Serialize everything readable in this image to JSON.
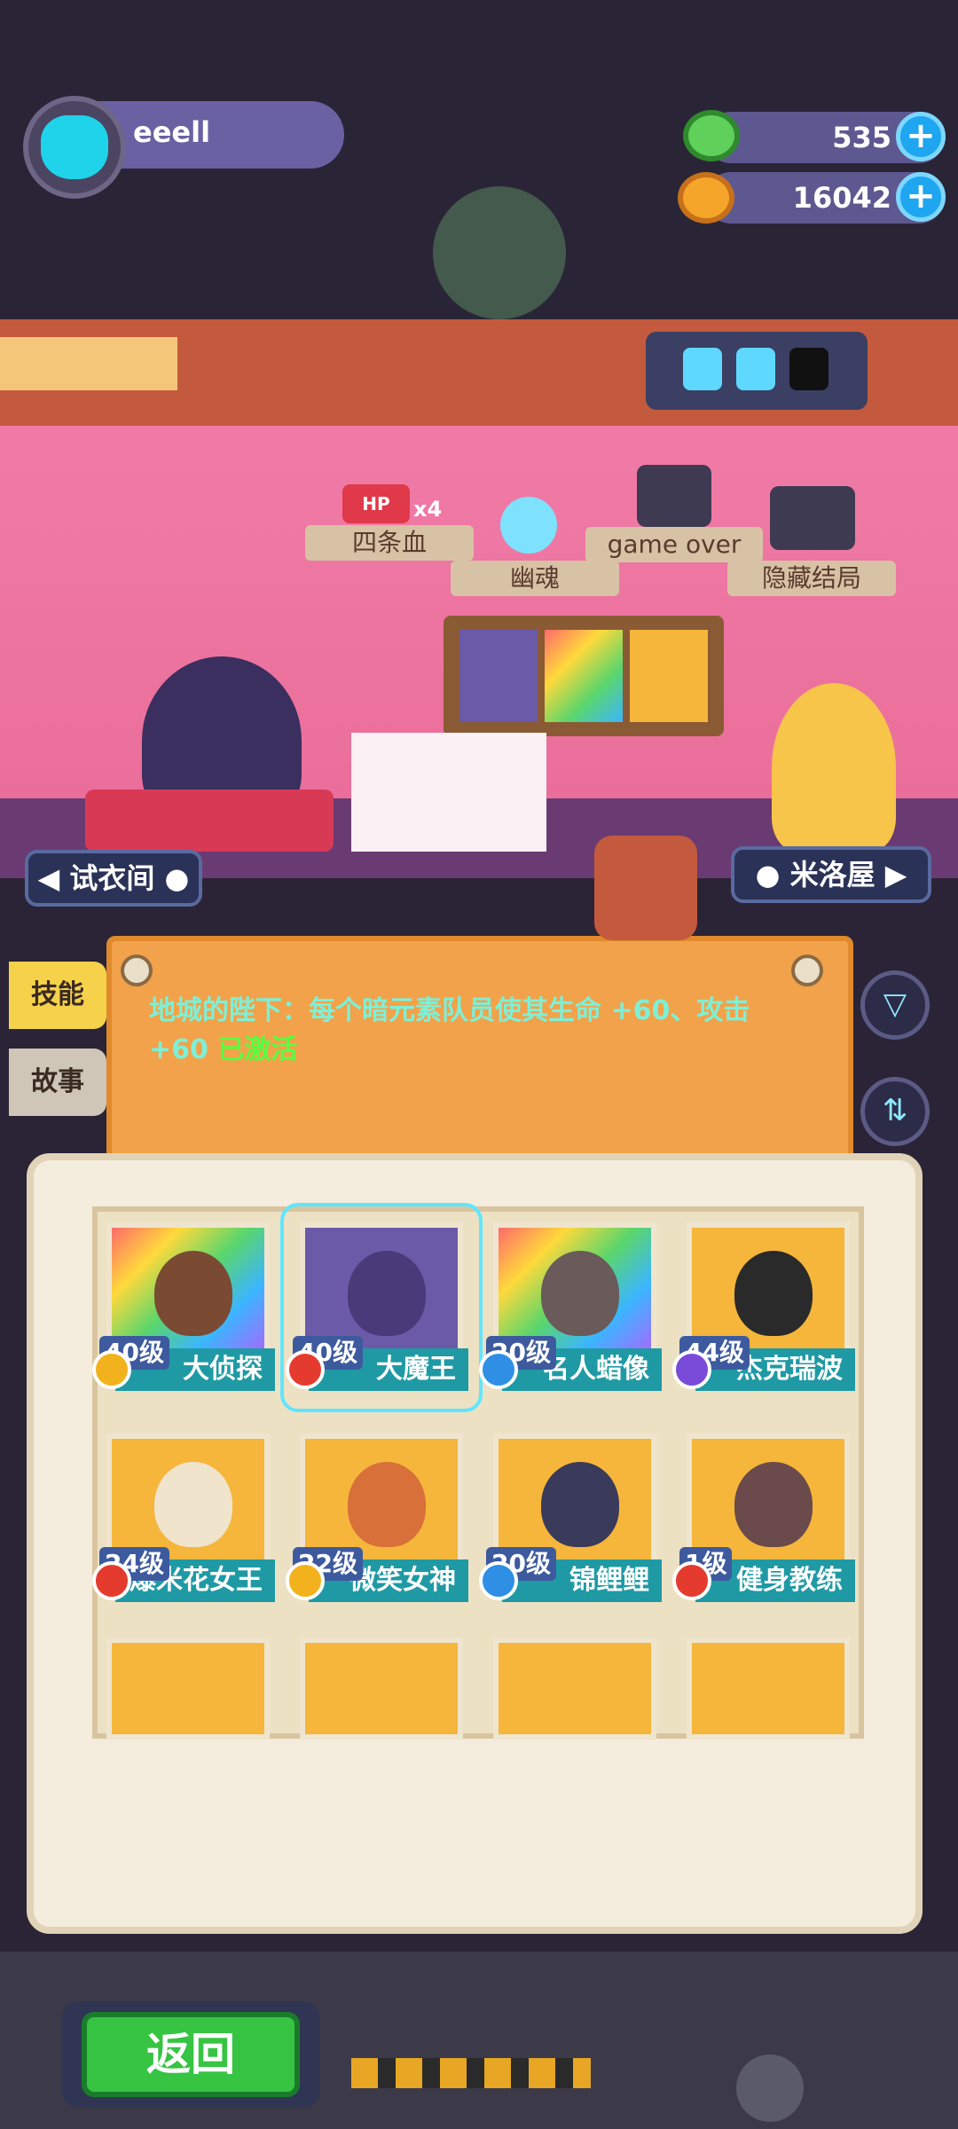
{
  "player": {
    "name": "eeell"
  },
  "currency": [
    {
      "icon": "green-donut-icon",
      "value": "535",
      "color": "#5fd05a"
    },
    {
      "icon": "orange-planet-icon",
      "value": "16042",
      "color": "#f5a52a"
    }
  ],
  "shelf": {
    "hp_badge": "HP",
    "hp_multiplier": "x4",
    "items": [
      "四条血",
      "幽魂",
      "game over",
      "隐藏结局"
    ]
  },
  "nav": {
    "left": "◀ 试衣间 ●",
    "right": "● 米洛屋 ▶"
  },
  "side_tabs": [
    "技能",
    "故事"
  ],
  "skill": {
    "text": "地城的陛下：每个暗元素队员使其生命 +60、攻击 +60",
    "status": "已激活"
  },
  "cards": [
    {
      "name": "大侦探",
      "level": "40级",
      "element_color": "#f2b21e",
      "art": "rainbow",
      "face": "#7a4a32"
    },
    {
      "name": "大魔王",
      "level": "40级",
      "element_color": "#e53b2e",
      "art": "purple",
      "face": "#4a3a7a"
    },
    {
      "name": "名人蜡像",
      "level": "20级",
      "element_color": "#2e8fe5",
      "art": "rainbow",
      "face": "#6a5a5a"
    },
    {
      "name": "杰克瑞波",
      "level": "44级",
      "element_color": "#7a4ad8",
      "art": "orange",
      "face": "#2a2a2a"
    },
    {
      "name": "爆米花女王",
      "level": "24级",
      "element_color": "#e53b2e",
      "art": "orange",
      "face": "#f0e4cc"
    },
    {
      "name": "微笑女神",
      "level": "22级",
      "element_color": "#f2b21e",
      "art": "orange",
      "face": "#d8703a"
    },
    {
      "name": "锦鲤鲤",
      "level": "20级",
      "element_color": "#2e8fe5",
      "art": "orange",
      "face": "#3a3a5a"
    },
    {
      "name": "健身教练",
      "level": "1级",
      "element_color": "#e53b2e",
      "art": "orange",
      "face": "#6a4a4a"
    }
  ],
  "back_button": "返回"
}
